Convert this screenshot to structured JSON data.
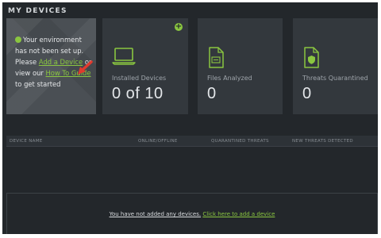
{
  "header": {
    "title": "MY DEVICES"
  },
  "setup": {
    "line1": "Your environment has not been set up.",
    "please": "Please",
    "add_device_link": "Add a Device",
    "or_view": "or view our",
    "guide_link": "How To Guide",
    "tail": "to get started"
  },
  "cards": [
    {
      "icon": "laptop-icon",
      "label": "Installed Devices",
      "value": "0 of 10"
    },
    {
      "icon": "file-icon",
      "label": "Files Analyzed",
      "value": "0"
    },
    {
      "icon": "shield-file-icon",
      "label": "Threats Quarantined",
      "value": "0"
    }
  ],
  "add_badge": "+",
  "table": {
    "columns": [
      "DEVICE NAME",
      "ONLINE/OFFLINE",
      "QUARANTINED THREATS",
      "NEW THREATS DETECTED"
    ]
  },
  "empty": {
    "message": "You have not added any devices.",
    "cta": "Click here to add a device"
  },
  "colors": {
    "accent": "#8ac640",
    "background": "#23272b",
    "card": "#33383d",
    "arrow": "#e03a2e"
  }
}
